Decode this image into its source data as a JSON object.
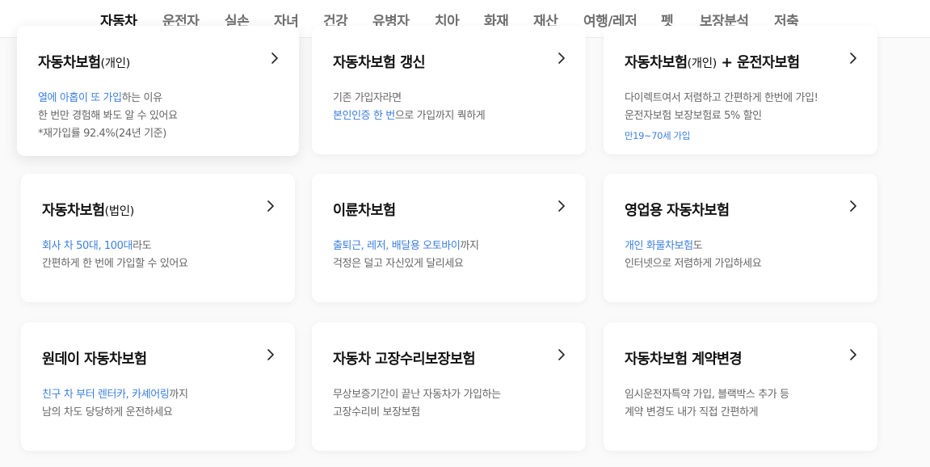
{
  "nav": {
    "tabs": [
      "자동차",
      "운전자",
      "실손",
      "자녀",
      "건강",
      "유병자",
      "치아",
      "화재",
      "재산",
      "여행/레저",
      "펫",
      "보장분석",
      "저축"
    ],
    "active_index": 0
  },
  "cards": [
    {
      "title": "자동차보험",
      "title_sub": "(개인)",
      "lines": [
        [
          {
            "t": "열에 아홉이 또 가입",
            "hl": true
          },
          {
            "t": "하는 이유"
          }
        ],
        [
          {
            "t": "한 번만 경험해 봐도 알 수 있어요"
          }
        ],
        [
          {
            "t": "*재가입률 92.4%(24년 기준)"
          }
        ]
      ]
    },
    {
      "title": "자동차보험 갱신",
      "title_sub": "",
      "lines": [
        [
          {
            "t": "기존 가입자라면"
          }
        ],
        [
          {
            "t": "본인인증 한 번",
            "hl": true
          },
          {
            "t": "으로 가입까지 쿽하게"
          }
        ]
      ]
    },
    {
      "title": "자동차보험",
      "title_sub": "(개인)",
      "title_tail": " + 운전자보험",
      "lines": [
        [
          {
            "t": "다이렉트여서 저렴하고 간편하게 한번에 가입!"
          }
        ],
        [
          {
            "t": "운전자보험 보장보험료 5% 할인"
          }
        ],
        [
          {
            "t": "만19~70세 가입",
            "small": true
          }
        ]
      ]
    },
    {
      "title": "자동차보험",
      "title_sub": "(법인)",
      "lines": [
        [
          {
            "t": "회사 차 50대, 100대",
            "hl": true
          },
          {
            "t": "라도"
          }
        ],
        [
          {
            "t": "간편하게 한 번에 가입할 수 있어요"
          }
        ]
      ]
    },
    {
      "title": "이륜차보험",
      "title_sub": "",
      "lines": [
        [
          {
            "t": "출퇴근, 레저, 배달용 오토바이",
            "hl": true
          },
          {
            "t": "까지"
          }
        ],
        [
          {
            "t": "걱정은 덜고 자신있게 달리세요"
          }
        ]
      ]
    },
    {
      "title": "영업용 자동차보험",
      "title_sub": "",
      "lines": [
        [
          {
            "t": "개인 화물차보험",
            "hl": true
          },
          {
            "t": "도"
          }
        ],
        [
          {
            "t": "인터넷으로 저렴하게 가입하세요"
          }
        ]
      ]
    },
    {
      "title": "원데이 자동차보험",
      "title_sub": "",
      "lines": [
        [
          {
            "t": "친구 차 부터 렌터카, 카셰어링",
            "hl": true
          },
          {
            "t": "까지"
          }
        ],
        [
          {
            "t": "남의 차도 당당하게 운전하세요"
          }
        ]
      ]
    },
    {
      "title": "자동차 고장수리보장보험",
      "title_sub": "",
      "lines": [
        [
          {
            "t": "무상보증기간이 끝난 자동차가 가입하는"
          }
        ],
        [
          {
            "t": "고장수리비 보장보험"
          }
        ]
      ]
    },
    {
      "title": "자동차보험 계약변경",
      "title_sub": "",
      "lines": [
        [
          {
            "t": "임시운전자특약 가입, 블랙박스 추가 등"
          }
        ],
        [
          {
            "t": "계약 변경도 내가 직접 간편하게"
          }
        ]
      ]
    }
  ],
  "colors": {
    "accent": "#3c7fdc",
    "title": "#111111",
    "desc": "#666666"
  }
}
